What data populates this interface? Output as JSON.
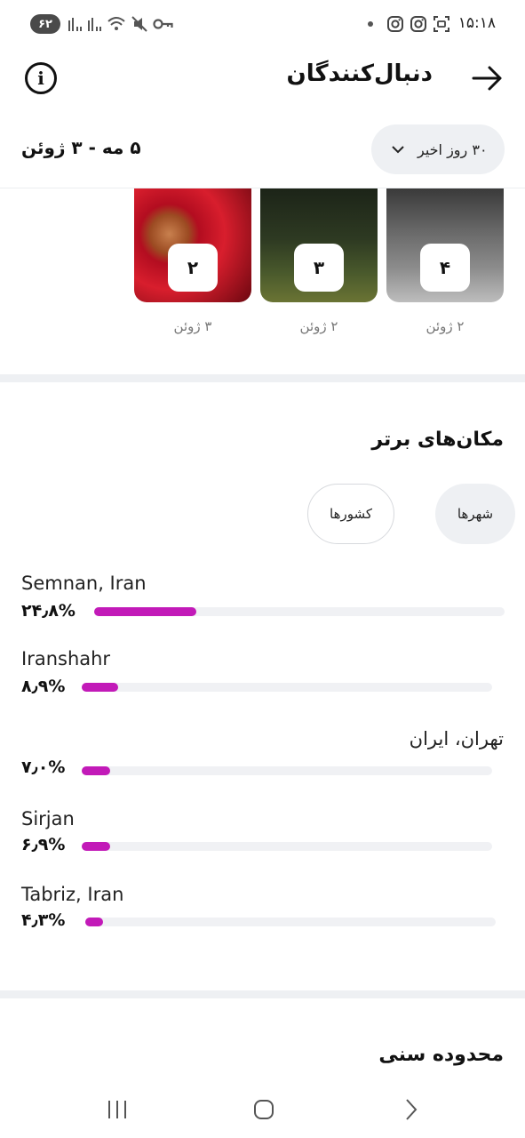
{
  "status_bar": {
    "battery": "۶۲",
    "time": "۱۵:۱۸",
    "icons": [
      "signal-icon",
      "signal-icon",
      "wifi-icon",
      "mute-icon",
      "vpn-key-icon",
      "dot-icon",
      "instagram-icon",
      "instagram-icon",
      "screenshot-icon"
    ]
  },
  "header": {
    "title": "دنبال‌کنندگان",
    "info_icon": "info-icon",
    "back_icon": "arrow-right-icon"
  },
  "range": {
    "date_range": "۵ مه - ۳ ژوئن",
    "period_label": "۳۰ روز اخیر",
    "dropdown_icon": "chevron-down-icon"
  },
  "posts": [
    {
      "rank": "۲",
      "date": "۳ ژوئن"
    },
    {
      "rank": "۳",
      "date": "۲ ژوئن"
    },
    {
      "rank": "۴",
      "date": "۲ ژوئن"
    }
  ],
  "top_locations": {
    "title": "مکان‌های برتر",
    "tabs": {
      "cities": "شهرها",
      "countries": "کشورها"
    },
    "selected_tab": "cities",
    "accent_color": "#c21ab8",
    "items": [
      {
        "name": "Semnan, Iran",
        "percent_label": "۲۴٫۸%",
        "value": 24.8
      },
      {
        "name": "Iranshahr",
        "percent_label": "۸٫۹%",
        "value": 8.9
      },
      {
        "name": "تهران، ایران",
        "percent_label": "۷٫۰%",
        "value": 7.0
      },
      {
        "name": "Sirjan",
        "percent_label": "۶٫۹%",
        "value": 6.9
      },
      {
        "name": "Tabriz, Iran",
        "percent_label": "۴٫۳%",
        "value": 4.3
      }
    ]
  },
  "age_range": {
    "title": "محدوده سنی"
  },
  "nav": {
    "recents_icon": "recents-icon",
    "home_icon": "home-icon",
    "back_icon": "back-chevron-icon"
  }
}
